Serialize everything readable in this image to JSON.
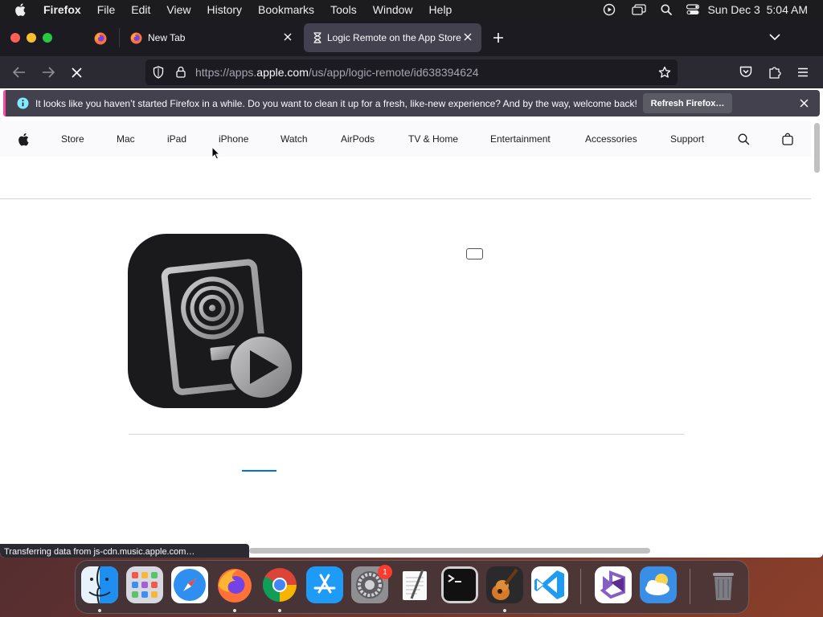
{
  "menubar": {
    "app_name": "Firefox",
    "items": [
      "File",
      "Edit",
      "View",
      "History",
      "Bookmarks",
      "Tools",
      "Window",
      "Help"
    ],
    "clock": "Sun Dec 3  5:04 AM"
  },
  "browser": {
    "tabs": [
      {
        "title": "New Tab",
        "active": false
      },
      {
        "title": "Logic Remote on the App Store",
        "active": true
      }
    ],
    "url": {
      "prefix": "https://apps.",
      "domain": "apple.com",
      "path": "/us/app/logic-remote/id638394624"
    },
    "notification": {
      "message": "It looks like you haven’t started Firefox in a while. Do you want to clean it up for a fresh, like-new experience? And by the way, welcome back!",
      "button": "Refresh Firefox…"
    },
    "status": "Transferring data from js-cdn.music.apple.com…"
  },
  "apple_nav": {
    "items": [
      "Store",
      "Mac",
      "iPad",
      "iPhone",
      "Watch",
      "AirPods",
      "TV & Home",
      "Entertainment",
      "Accessories",
      "Support"
    ]
  },
  "dock": {
    "apps": [
      "Finder",
      "Launchpad",
      "Safari",
      "Firefox",
      "Chrome",
      "App Store",
      "System Settings",
      "TextEdit",
      "Terminal",
      "GarageBand",
      "Visual Studio Code",
      "Visual Studio",
      "Weather",
      "Trash"
    ],
    "settings_badge": "1"
  },
  "colors": {
    "accent_blue": "#0071e3",
    "firefox_orange": "#ff7139",
    "notification_bg": "#42414d",
    "tab_bg": "#1c1b22"
  }
}
